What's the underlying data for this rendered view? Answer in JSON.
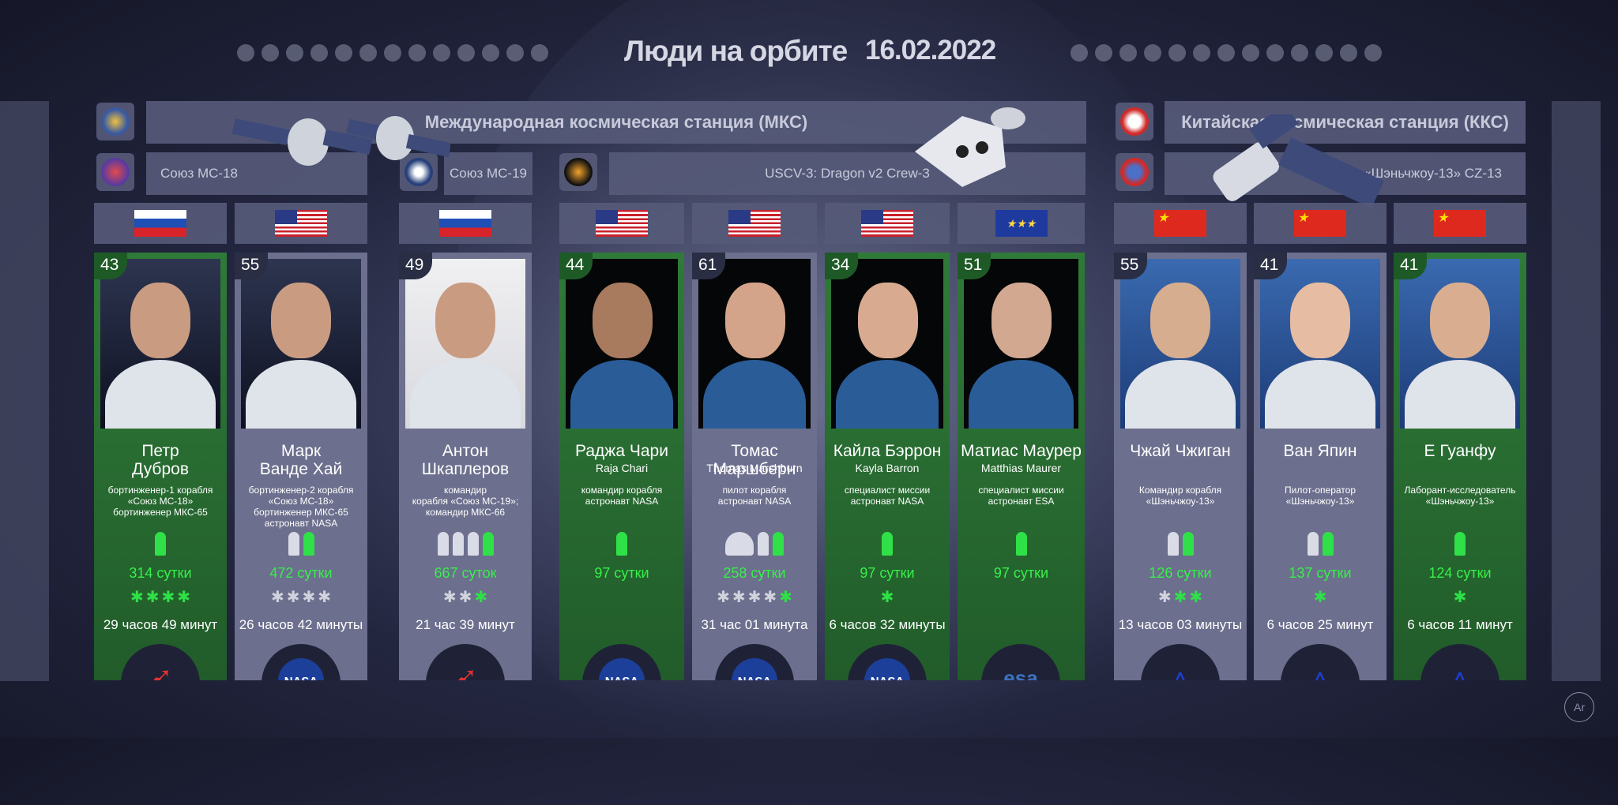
{
  "header": {
    "title": "Люди на орбите",
    "date": "16.02.2022"
  },
  "stations": {
    "iss": "Международная космическая станция (МКС)",
    "css": "Китайская космическая станция (ККС)"
  },
  "missions": {
    "soyuz18": "Союз МС-18",
    "soyuz19": "Союз МС-19",
    "crew3": "USCV-3: Dragon v2 Crew-3",
    "sz13": "«Шэньчжоу-13» CZ-13"
  },
  "flags": {
    "ru": "Russia",
    "us": "USA",
    "eu": "EU",
    "cn": "China"
  },
  "colors": {
    "active_card": "#2f7a38",
    "inactive_card": "#6c6f8d",
    "days_text": "#37f04a"
  },
  "crew": [
    {
      "age": "43",
      "name1": "Петр",
      "name2": "Дубров",
      "latin": "",
      "role1": "бортинженер-1 корабля",
      "role2": "«Союз МС-18»",
      "role3": "бортинженер МКС-65",
      "days": "314 сутки",
      "eva": "29 часов 49 минут",
      "agency": "roscosmos-logo"
    },
    {
      "age": "55",
      "name1": "Марк",
      "name2": "Ванде Хай",
      "latin": "",
      "role1": "бортинженер-2 корабля",
      "role2": "«Союз МС-18»",
      "role3": "бортинженер МКС-65",
      "role4": "астронавт NASA",
      "days": "472 сутки",
      "eva": "26 часов 42 минуты",
      "agency": "nasa-logo"
    },
    {
      "age": "49",
      "name1": "Антон",
      "name2": "Шкаплеров",
      "latin": "",
      "role1": "командир",
      "role2": "корабля «Союз МС-19»;",
      "role3": "командир МКС-66",
      "days": "667 суток",
      "eva": "21 час 39 минут",
      "agency": "roscosmos-logo"
    },
    {
      "age": "44",
      "name1": "Раджа Чари",
      "latin": "Raja Chari",
      "role1": "командир корабля",
      "role2": "астронавт NASA",
      "days": "97 сутки",
      "eva": "",
      "agency": "nasa-logo"
    },
    {
      "age": "61",
      "name1": "Томас Маршберн",
      "latin": "Thomas Marshburn",
      "role1": "пилот корабля",
      "role2": "астронавт NASA",
      "days": "258 сутки",
      "eva": "31 час 01 минута",
      "agency": "nasa-logo"
    },
    {
      "age": "34",
      "name1": "Кайла Бэррон",
      "latin": "Kayla Barron",
      "role1": "специалист миссии",
      "role2": "астронавт NASA",
      "days": "97 сутки",
      "eva": "6 часов 32 минуты",
      "agency": "nasa-logo"
    },
    {
      "age": "51",
      "name1": "Матиас Маурер",
      "latin": "Matthias Maurer",
      "role1": "специалист миссии",
      "role2": "астронавт ESA",
      "days": "97 сутки",
      "eva": "",
      "agency": "esa-logo"
    },
    {
      "age": "55",
      "name1": "Чжай Чжиган",
      "latin": "",
      "role1": "Командир корабля",
      "role2": "«Шэньчжоу-13»",
      "days": "126 сутки",
      "eva": "13 часов 03 минуты",
      "agency": "cmsa-logo"
    },
    {
      "age": "41",
      "name1": "Ван Япин",
      "latin": "",
      "role1": "Пилот-оператор",
      "role2": "«Шэньчжоу-13»",
      "days": "137 сутки",
      "eva": "6 часов 25 минут",
      "agency": "cmsa-logo"
    },
    {
      "age": "41",
      "name1": "Е Гуанфу",
      "latin": "",
      "role1": "Лаборант-исследователь",
      "role2": "«Шэньчжоу-13»",
      "days": "124 сутки",
      "eva": "6 часов 11 минут",
      "agency": "cmsa-logo"
    }
  ],
  "esa_text": "esa",
  "nasa_text": "NASA",
  "signature": "Ar"
}
